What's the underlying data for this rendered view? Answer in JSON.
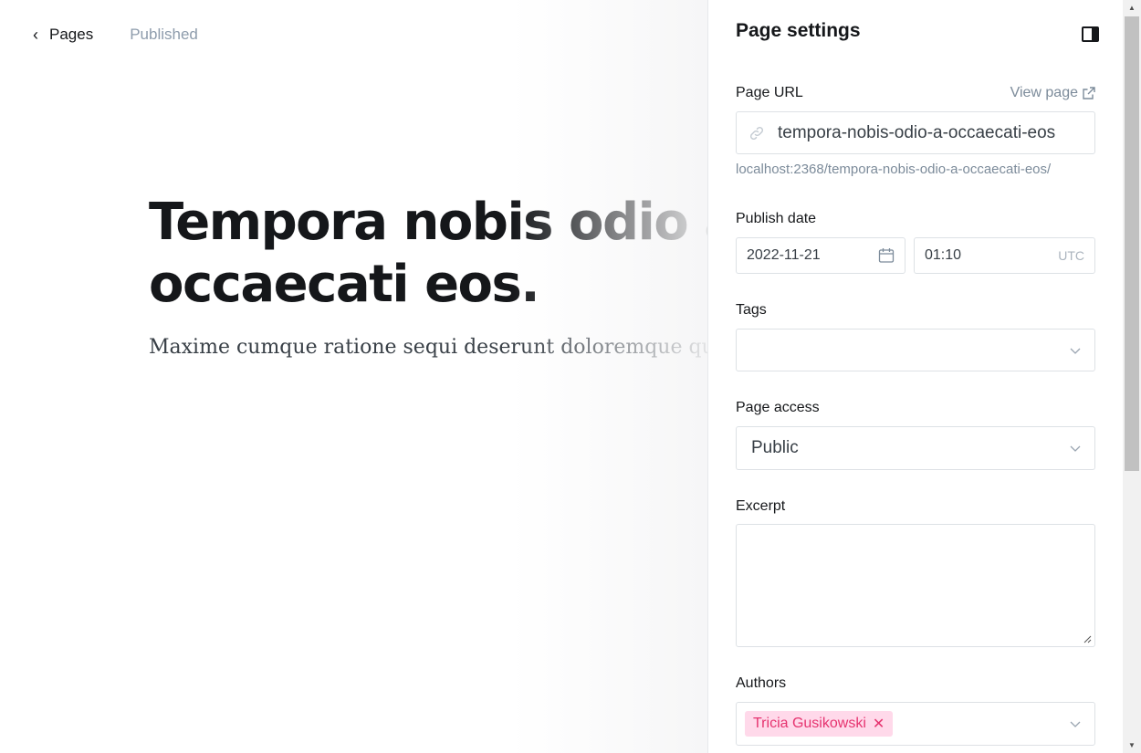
{
  "editor": {
    "back_label": "Pages",
    "status": "Published",
    "title": "Tempora nobis odio a occaecati eos.",
    "excerpt": "Maxime cumque ratione sequi deserunt doloremque quis."
  },
  "panel": {
    "title": "Page settings",
    "page_url": {
      "label": "Page URL",
      "view_page": "View page",
      "value": "tempora-nobis-odio-a-occaecati-eos",
      "hint": "localhost:2368/tempora-nobis-odio-a-occaecati-eos/"
    },
    "publish_date": {
      "label": "Publish date",
      "date": "2022-11-21",
      "time": "01:10",
      "timezone": "UTC"
    },
    "tags": {
      "label": "Tags"
    },
    "access": {
      "label": "Page access",
      "value": "Public"
    },
    "excerpt": {
      "label": "Excerpt"
    },
    "authors": {
      "label": "Authors",
      "items": [
        "Tricia Gusikowski"
      ]
    }
  },
  "colors": {
    "accent_pink": "#e6336f",
    "tag_bg": "#ffd9ea",
    "muted": "#7c8b9a",
    "border": "#dde1e5"
  },
  "icons": [
    "chevron-left-icon",
    "sidebar-toggle-icon",
    "external-link-icon",
    "link-icon",
    "calendar-icon",
    "chevron-down-icon",
    "close-icon"
  ]
}
